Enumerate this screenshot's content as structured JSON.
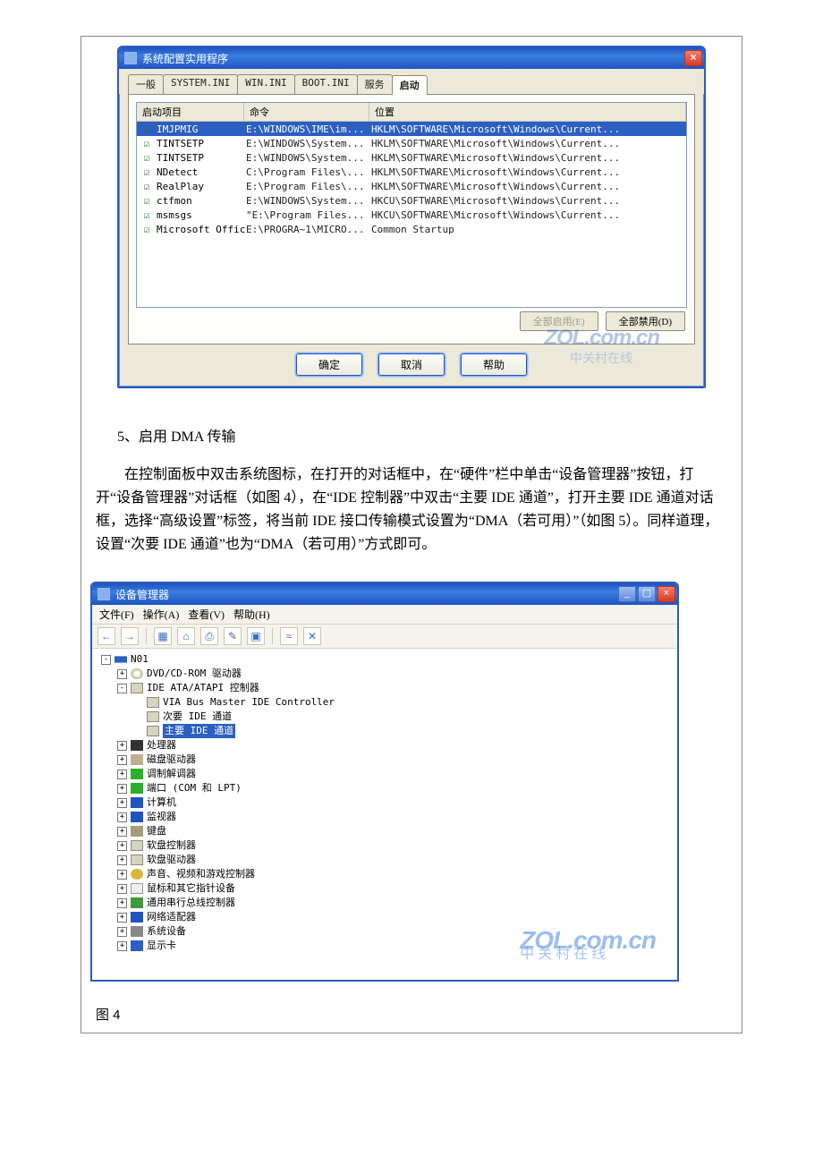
{
  "doc": {
    "section_heading": "5、启用 DMA 传输",
    "paragraph": "在控制面板中双击系统图标，在打开的对话框中，在“硬件”栏中单击“设备管理器”按钮，打开“设备管理器”对话框（如图 4），在“IDE 控制器”中双击“主要 IDE 通道”，打开主要 IDE 通道对话框，选择“高级设置”标签，将当前 IDE 接口传输模式设置为“DMA（若可用）”（如图 5）。同样道理，设置“次要 IDE 通道”也为“DMA（若可用）”方式即可。",
    "fig4_caption": "图 4"
  },
  "msconfig": {
    "title": "系统配置实用程序",
    "tabs": [
      "一般",
      "SYSTEM.INI",
      "WIN.INI",
      "BOOT.INI",
      "服务",
      "启动"
    ],
    "active_tab": "启动",
    "columns": {
      "item": "启动项目",
      "cmd": "命令",
      "loc": "位置"
    },
    "rows": [
      {
        "checked": true,
        "name": "IMJPMIG",
        "cmd": "E:\\WINDOWS\\IME\\im...",
        "loc": "HKLM\\SOFTWARE\\Microsoft\\Windows\\Current...",
        "selected": true
      },
      {
        "checked": true,
        "name": "TINTSETP",
        "cmd": "E:\\WINDOWS\\System...",
        "loc": "HKLM\\SOFTWARE\\Microsoft\\Windows\\Current..."
      },
      {
        "checked": true,
        "name": "TINTSETP",
        "cmd": "E:\\WINDOWS\\System...",
        "loc": "HKLM\\SOFTWARE\\Microsoft\\Windows\\Current..."
      },
      {
        "checked": true,
        "name": "NDetect",
        "cmd": "C:\\Program Files\\...",
        "loc": "HKLM\\SOFTWARE\\Microsoft\\Windows\\Current..."
      },
      {
        "checked": true,
        "name": "RealPlay",
        "cmd": "E:\\Program Files\\...",
        "loc": "HKLM\\SOFTWARE\\Microsoft\\Windows\\Current..."
      },
      {
        "checked": true,
        "name": "ctfmon",
        "cmd": "E:\\WINDOWS\\System...",
        "loc": "HKCU\\SOFTWARE\\Microsoft\\Windows\\Current..."
      },
      {
        "checked": true,
        "name": "msmsgs",
        "cmd": "\"E:\\Program Files...",
        "loc": "HKCU\\SOFTWARE\\Microsoft\\Windows\\Current..."
      },
      {
        "checked": true,
        "name": "Microsoft Office",
        "cmd": "E:\\PROGRA~1\\MICRO...",
        "loc": "Common Startup"
      }
    ],
    "enable_all": "全部启用(E)",
    "disable_all": "全部禁用(D)",
    "ok": "确定",
    "cancel": "取消",
    "help": "帮助",
    "watermark_top": "ZOL.com.cn",
    "watermark_bottom": "中关村在线"
  },
  "devmgr": {
    "title": "设备管理器",
    "menu": {
      "file": "文件(F)",
      "action": "操作(A)",
      "view": "查看(V)",
      "help": "帮助(H)"
    },
    "toolbar": [
      "←",
      "→",
      "|",
      "▦",
      "⌂",
      "⎙",
      "✎",
      "▣",
      "|",
      "≈",
      "✕"
    ],
    "root": "N01",
    "tree": [
      {
        "exp": "-",
        "ind": 0,
        "icon": "ni-pc",
        "label": "N01"
      },
      {
        "exp": "+",
        "ind": 1,
        "icon": "ni-cd",
        "label": "DVD/CD-ROM 驱动器"
      },
      {
        "exp": "-",
        "ind": 1,
        "icon": "ni-ide",
        "label": "IDE ATA/ATAPI 控制器"
      },
      {
        "exp": " ",
        "ind": 2,
        "icon": "ni-ide",
        "label": "VIA Bus Master IDE Controller"
      },
      {
        "exp": " ",
        "ind": 2,
        "icon": "ni-ide",
        "label": "次要 IDE 通道"
      },
      {
        "exp": " ",
        "ind": 2,
        "icon": "ni-ide",
        "label": "主要 IDE 通道",
        "selected": true
      },
      {
        "exp": "+",
        "ind": 1,
        "icon": "ni-chip",
        "label": "处理器"
      },
      {
        "exp": "+",
        "ind": 1,
        "icon": "ni-disk",
        "label": "磁盘驱动器"
      },
      {
        "exp": "+",
        "ind": 1,
        "icon": "ni-port",
        "label": "调制解调器"
      },
      {
        "exp": "+",
        "ind": 1,
        "icon": "ni-port",
        "label": "端口 (COM 和 LPT)"
      },
      {
        "exp": "+",
        "ind": 1,
        "icon": "ni-mon",
        "label": "计算机"
      },
      {
        "exp": "+",
        "ind": 1,
        "icon": "ni-mon",
        "label": "监视器"
      },
      {
        "exp": "+",
        "ind": 1,
        "icon": "ni-kb",
        "label": "键盘"
      },
      {
        "exp": "+",
        "ind": 1,
        "icon": "ni-fdd",
        "label": "软盘控制器"
      },
      {
        "exp": "+",
        "ind": 1,
        "icon": "ni-fdd",
        "label": "软盘驱动器"
      },
      {
        "exp": "+",
        "ind": 1,
        "icon": "ni-snd",
        "label": "声音、视频和游戏控制器"
      },
      {
        "exp": "+",
        "ind": 1,
        "icon": "ni-mouse",
        "label": "鼠标和其它指针设备"
      },
      {
        "exp": "+",
        "ind": 1,
        "icon": "ni-bus",
        "label": "通用串行总线控制器"
      },
      {
        "exp": "+",
        "ind": 1,
        "icon": "ni-net",
        "label": "网络适配器"
      },
      {
        "exp": "+",
        "ind": 1,
        "icon": "ni-sys",
        "label": "系统设备"
      },
      {
        "exp": "+",
        "ind": 1,
        "icon": "ni-gpu",
        "label": "显示卡"
      }
    ],
    "watermark_top": "ZOL.com.cn",
    "watermark_bottom": "中关村在线"
  }
}
